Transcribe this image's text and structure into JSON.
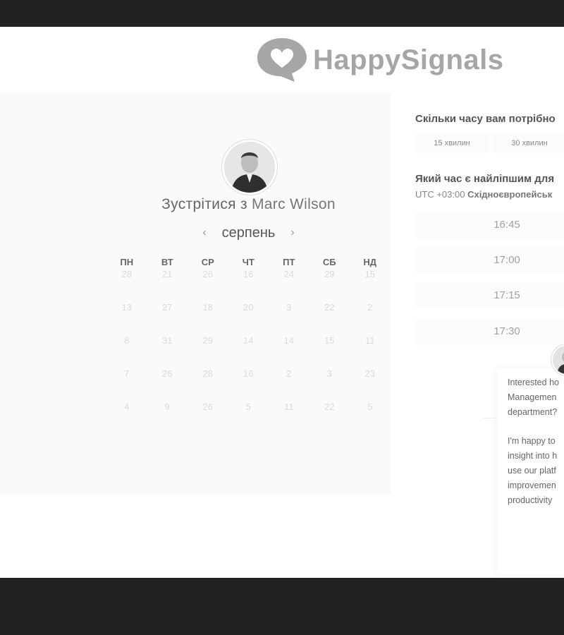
{
  "brand": {
    "name": "HappySignals",
    "icon": "heart-chat-icon"
  },
  "scheduler": {
    "meet_prefix": "Зустрітися з",
    "host_name": "Marc Wilson",
    "month": "серпень",
    "prev_icon": "chevron-left-icon",
    "next_icon": "chevron-right-icon",
    "weekdays": [
      "ПН",
      "ВТ",
      "СР",
      "ЧТ",
      "ПТ",
      "СБ",
      "НД"
    ],
    "weeks": [
      [
        "28",
        "21",
        "26",
        "16",
        "24",
        "29",
        "15"
      ],
      [
        "13",
        "27",
        "18",
        "20",
        "3",
        "22",
        "2"
      ],
      [
        "8",
        "31",
        "29",
        "14",
        "14",
        "15",
        "11"
      ],
      [
        "7",
        "26",
        "28",
        "16",
        "2",
        "3",
        "23"
      ],
      [
        "4",
        "9",
        "26",
        "5",
        "11",
        "22",
        "5"
      ]
    ]
  },
  "booking": {
    "duration_question": "Скільки часу вам потрібно",
    "durations": [
      "15 хвилин",
      "30 хвилин"
    ],
    "time_question": "Який час є найліпшим для",
    "timezone_offset": "UTC +03:00",
    "timezone_name": "Східноєвропейськ",
    "slots": [
      "16:45",
      "17:00",
      "17:15",
      "17:30"
    ]
  },
  "chat": {
    "lines_1": [
      "Interested ho",
      "Managemen",
      "department?"
    ],
    "lines_2": [
      "I'm happy to",
      "insight into h",
      "use our platf",
      "improvemen",
      "productivity"
    ]
  },
  "colors": {
    "frame": "#222222",
    "panel": "#fafafa",
    "logo": "#a6a6a6"
  }
}
